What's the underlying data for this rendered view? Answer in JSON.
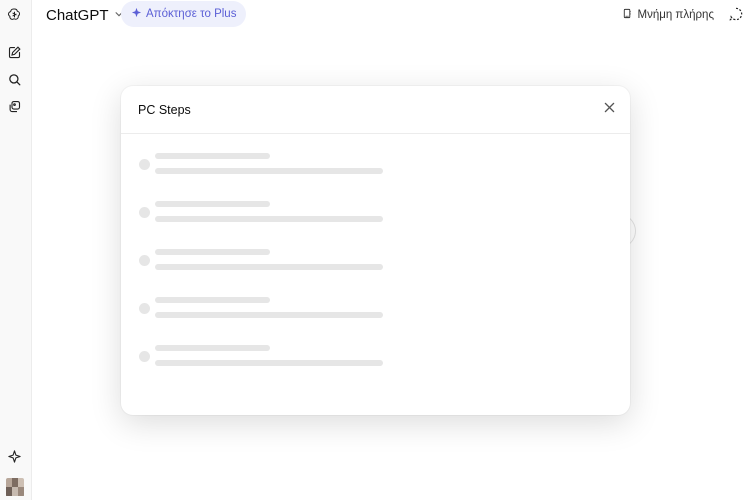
{
  "header": {
    "model_name": "ChatGPT",
    "upgrade_label": "Απόκτησε το Plus",
    "memory_label": "Μνήμη πλήρης"
  },
  "sidebar": {
    "icons": [
      "chatgpt-logo-icon",
      "new-chat-icon",
      "search-icon",
      "library-icon",
      "sparkle-icon"
    ]
  },
  "search_modal": {
    "query": "PC Steps",
    "loading_placeholder_rows": 5
  },
  "colors": {
    "accent": "#5b5fd6",
    "pill_bg": "#eef0fc",
    "skeleton": "#e6e6e6"
  }
}
